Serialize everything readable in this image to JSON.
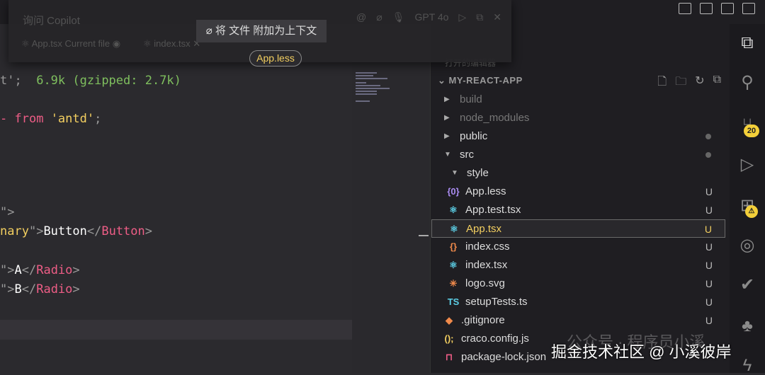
{
  "copilot": {
    "placeholder": "询问 Copilot",
    "model": "GPT 4o",
    "chips": [
      {
        "label": "App.tsx",
        "sub": "Current file"
      },
      {
        "label": "index.tsx"
      }
    ],
    "tooltip": "将 文件 附加为上下文",
    "drag_file": "App.less"
  },
  "code": {
    "l1": [
      "t';",
      "6.9k (gzipped: 2.7k)"
    ],
    "l2": [
      "from",
      "'antd'",
      ";"
    ],
    "l3": "\">",
    "l4": [
      "nary",
      "\">",
      "Button",
      "</",
      "Button",
      ">"
    ],
    "l5": [
      "\">",
      "A",
      "</",
      "Radio",
      ">"
    ],
    "l6": [
      "\">",
      "B",
      "</",
      "Radio",
      ">"
    ]
  },
  "explorer": {
    "open_editors": "打开的编辑器",
    "project": "MY-REACT-APP",
    "items": [
      {
        "name": "build",
        "type": "folder",
        "status": ""
      },
      {
        "name": "node_modules",
        "type": "folder",
        "status": ""
      },
      {
        "name": "public",
        "type": "folder",
        "status": "dot"
      },
      {
        "name": "src",
        "type": "folder-open",
        "status": "dot"
      },
      {
        "name": "style",
        "type": "folder-open",
        "status": ""
      },
      {
        "name": "App.less",
        "type": "less",
        "status": "U"
      },
      {
        "name": "App.test.tsx",
        "type": "react",
        "status": "U"
      },
      {
        "name": "App.tsx",
        "type": "react",
        "status": "U",
        "selected": true
      },
      {
        "name": "index.css",
        "type": "css",
        "status": "U"
      },
      {
        "name": "index.tsx",
        "type": "react",
        "status": "U"
      },
      {
        "name": "logo.svg",
        "type": "svg",
        "status": "U"
      },
      {
        "name": "setupTests.ts",
        "type": "ts",
        "status": "U"
      },
      {
        "name": ".gitignore",
        "type": "git",
        "status": "U"
      },
      {
        "name": "craco.config.js",
        "type": "js",
        "status": ""
      },
      {
        "name": "package-lock.json",
        "type": "json",
        "status": ""
      }
    ]
  },
  "activity": {
    "scm_badge": "20"
  },
  "watermark": {
    "line1": "公众号 · 程序员小溪",
    "line2": "掘金技术社区 @ 小溪彼岸"
  }
}
